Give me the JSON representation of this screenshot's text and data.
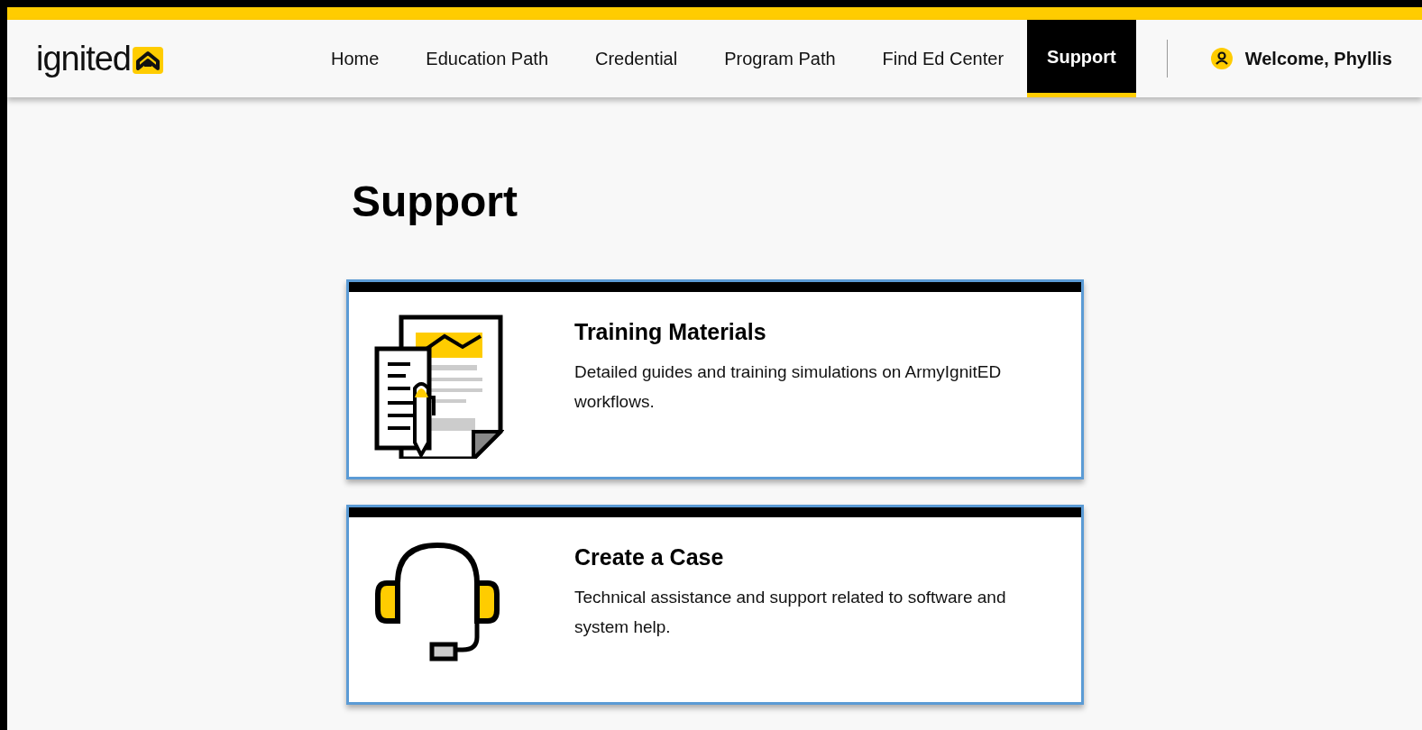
{
  "logo": {
    "text": "ignited"
  },
  "nav": [
    {
      "label": "Home",
      "selected": false
    },
    {
      "label": "Education Path",
      "selected": false
    },
    {
      "label": "Credential",
      "selected": false
    },
    {
      "label": "Program Path",
      "selected": false
    },
    {
      "label": "Find Ed Center",
      "selected": false
    },
    {
      "label": "Support",
      "selected": true
    }
  ],
  "user": {
    "greeting": "Welcome, Phyllis"
  },
  "page_title": "Support",
  "cards": [
    {
      "kind": "documents",
      "title": "Training Materials",
      "description": "Detailed guides and training simulations on ArmyIgnitED workflows."
    },
    {
      "kind": "headset",
      "title": "Create a Case",
      "description": "Technical assistance and support related to software and system help."
    }
  ]
}
